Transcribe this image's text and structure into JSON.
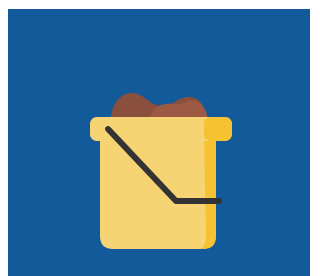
{
  "background_color": "#135a9a",
  "illustration": {
    "icon": "bucket-icon",
    "bucket_color": "#f6d373",
    "bucket_shade_color": "#f5c232",
    "contents_color": "#8b4f3d",
    "contents_highlight_color": "#9c5a45",
    "handle_color": "#333333"
  }
}
